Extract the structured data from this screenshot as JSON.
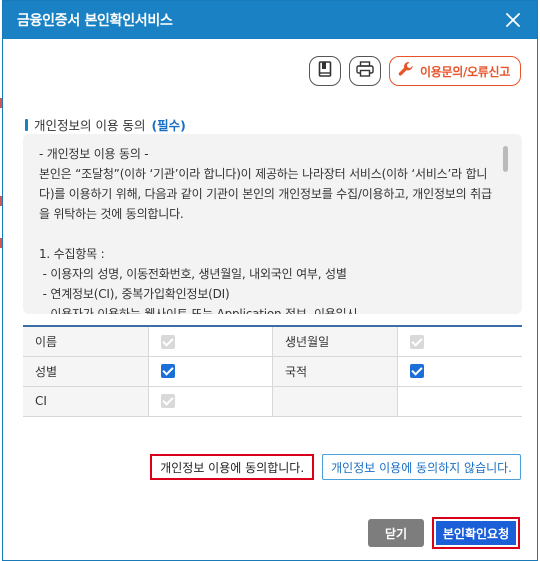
{
  "dialog": {
    "title": "금융인증서 본인확인서비스"
  },
  "toolbar": {
    "book_icon": "book-icon",
    "print_icon": "print-icon",
    "report_icon": "wrench-icon",
    "report_label": "이용문의/오류신고"
  },
  "consent": {
    "section_title": "개인정보의 이용 동의",
    "required_label": "(필수)",
    "terms_text": "- 개인정보 이용 동의 -\n본인은 “조달청”(이하 ‘기관’이라 합니다)이 제공하는 나라장터 서비스(이하 ‘서비스’라 합니다)를 이용하기 위해, 다음과 같이 기관이 본인의 개인정보를 수집/이용하고, 개인정보의 취급을 위탁하는 것에 동의합니다.\n\n1. 수집항목 :\n - 이용자의 성명, 이동전화번호, 생년월일, 내외국인 여부, 성별\n - 연계정보(CI), 중복가입확인정보(DI)\n - 이용자가 이용하는 웹사이트 또는 Application 정보, 이용일시"
  },
  "info_table": {
    "rows": [
      {
        "label1": "이름",
        "checked1": false,
        "label2": "생년월일",
        "checked2": false
      },
      {
        "label1": "성별",
        "checked1": true,
        "label2": "국적",
        "checked2": true
      },
      {
        "label1": "CI",
        "checked1": false,
        "label2": "",
        "checked2": null
      }
    ]
  },
  "buttons": {
    "agree": "개인정보 이용에 동의합니다.",
    "disagree": "개인정보 이용에 동의하지 않습니다.",
    "close": "닫기",
    "request": "본인확인요청"
  },
  "colors": {
    "title_bar": "#1a82c4",
    "accent_orange": "#e8542a",
    "checkbox_on": "#1a6fd8",
    "highlight_red": "#d9001b"
  }
}
